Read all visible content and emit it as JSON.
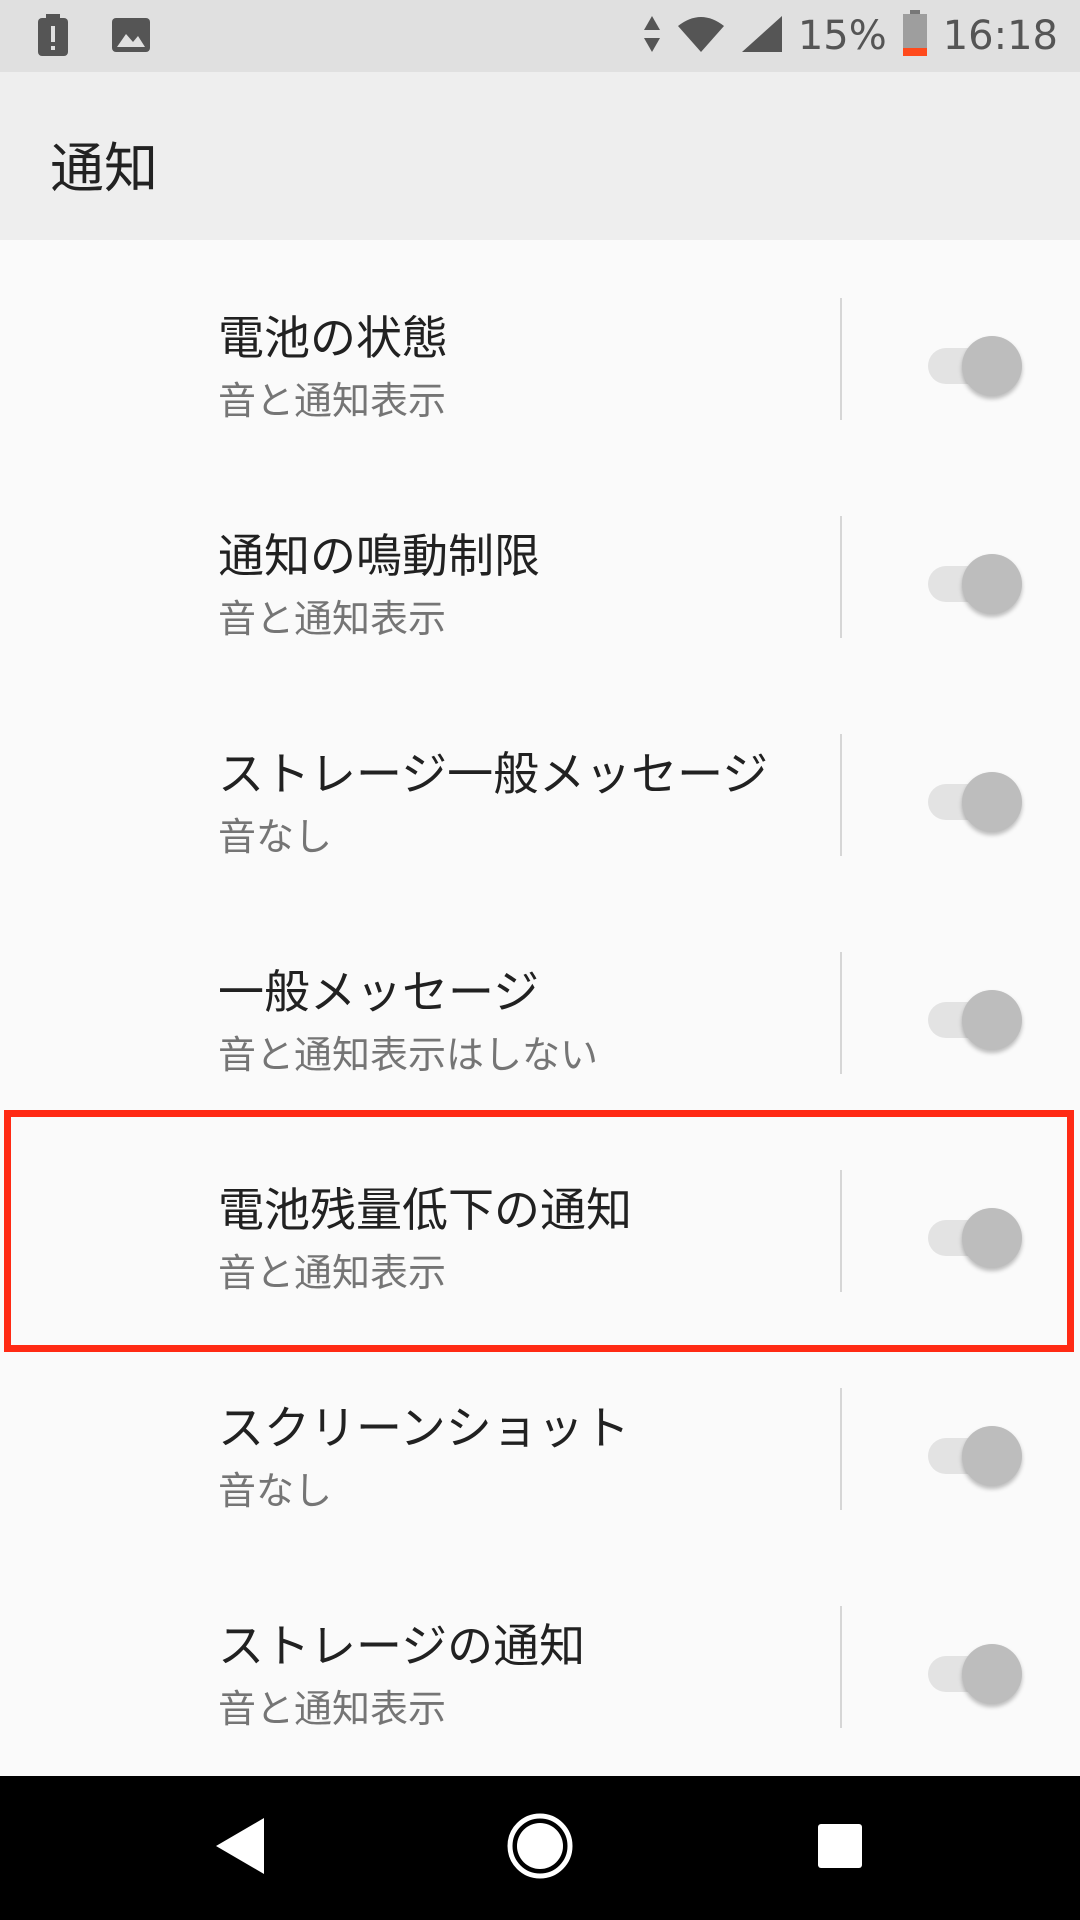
{
  "status_bar": {
    "left_icons": [
      "alert-icon",
      "image-icon"
    ],
    "battery_percent": "15%",
    "time": "16:18",
    "battery_color": "#ff4a1c"
  },
  "toolbar": {
    "title": "通知"
  },
  "list": {
    "items": [
      {
        "title": "電池の状態",
        "summary": "音と通知表示",
        "enabled": false
      },
      {
        "title": "通知の鳴動制限",
        "summary": "音と通知表示",
        "enabled": false
      },
      {
        "title": "ストレージ一般メッセージ",
        "summary": "音なし",
        "enabled": false
      },
      {
        "title": "一般メッセージ",
        "summary": "音と通知表示はしない",
        "enabled": false
      },
      {
        "title": "電池残量低下の通知",
        "summary": "音と通知表示",
        "enabled": false
      },
      {
        "title": "スクリーンショット",
        "summary": "音なし",
        "enabled": false
      },
      {
        "title": "ストレージの通知",
        "summary": "音と通知表示",
        "enabled": false
      }
    ],
    "highlighted_index": 4,
    "highlight_color": "#ff2a14"
  },
  "nav_bar": {
    "buttons": [
      "back-icon",
      "home-icon",
      "recents-icon"
    ]
  }
}
